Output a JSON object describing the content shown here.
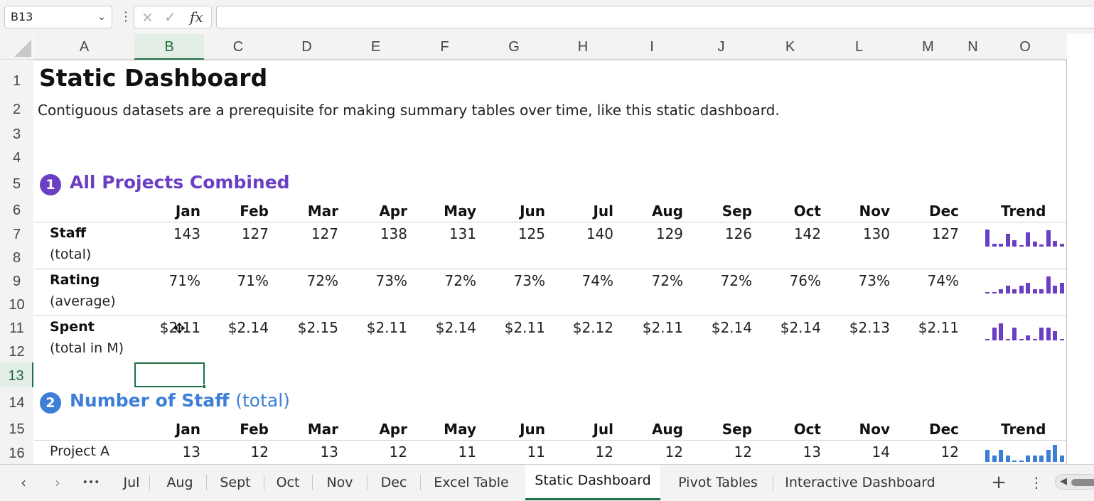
{
  "formula_bar": {
    "name_box": "B13",
    "cancel_icon": "×",
    "enter_icon": "✓",
    "fx_label": "fx",
    "formula_value": ""
  },
  "columns": [
    "A",
    "B",
    "C",
    "D",
    "E",
    "F",
    "G",
    "H",
    "I",
    "J",
    "K",
    "L",
    "M",
    "N",
    "O"
  ],
  "rows": [
    "1",
    "2",
    "3",
    "4",
    "5",
    "6",
    "7",
    "8",
    "9",
    "10",
    "11",
    "12",
    "13",
    "14",
    "15",
    "16"
  ],
  "selected_cell": "B13",
  "sheet": {
    "title": "Static Dashboard",
    "subtitle": "Contiguous datasets are a prerequisite for making summary tables over time, like this static dashboard.",
    "section1": {
      "number": "1",
      "title": "All Projects Combined",
      "color": "#6a3fc4",
      "months": [
        "Jan",
        "Feb",
        "Mar",
        "Apr",
        "May",
        "Jun",
        "Jul",
        "Aug",
        "Sep",
        "Oct",
        "Nov",
        "Dec"
      ],
      "trend_label": "Trend",
      "metrics": [
        {
          "label": "Staff",
          "sub": "(total)",
          "values": [
            "143",
            "127",
            "127",
            "138",
            "131",
            "125",
            "140",
            "129",
            "126",
            "142",
            "130",
            "127"
          ],
          "spark": [
            143,
            127,
            127,
            138,
            131,
            125,
            140,
            129,
            126,
            142,
            130,
            127
          ]
        },
        {
          "label": "Rating",
          "sub": "(average)",
          "values": [
            "71%",
            "71%",
            "72%",
            "73%",
            "72%",
            "73%",
            "74%",
            "72%",
            "72%",
            "76%",
            "73%",
            "74%"
          ],
          "spark": [
            71,
            71,
            72,
            73,
            72,
            73,
            74,
            72,
            72,
            76,
            73,
            74
          ]
        },
        {
          "label": "Spent",
          "sub": "(total in M)",
          "values": [
            "$2.11",
            "$2.14",
            "$2.15",
            "$2.11",
            "$2.14",
            "$2.11",
            "$2.12",
            "$2.11",
            "$2.14",
            "$2.14",
            "$2.13",
            "$2.11"
          ],
          "spark": [
            2.11,
            2.14,
            2.15,
            2.11,
            2.14,
            2.11,
            2.12,
            2.11,
            2.14,
            2.14,
            2.13,
            2.11
          ]
        }
      ]
    },
    "section2": {
      "number": "2",
      "title": "Number of Staff",
      "title_suffix": "(total)",
      "color": "#3d7fd6",
      "months": [
        "Jan",
        "Feb",
        "Mar",
        "Apr",
        "May",
        "Jun",
        "Jul",
        "Aug",
        "Sep",
        "Oct",
        "Nov",
        "Dec"
      ],
      "trend_label": "Trend",
      "rows": [
        {
          "label": "Project A",
          "values": [
            "13",
            "12",
            "13",
            "12",
            "11",
            "11",
            "12",
            "12",
            "12",
            "13",
            "14",
            "12"
          ],
          "spark": [
            13,
            12,
            13,
            12,
            11,
            11,
            12,
            12,
            12,
            13,
            14,
            12
          ]
        }
      ]
    }
  },
  "tabs": {
    "prev": "‹",
    "next": "›",
    "more": "•••",
    "items": [
      "Jul",
      "Aug",
      "Sept",
      "Oct",
      "Nov",
      "Dec",
      "Excel Table",
      "Static Dashboard",
      "Pivot Tables",
      "Interactive Dashboard"
    ],
    "active": "Static Dashboard",
    "add": "+",
    "menu": "⋮"
  }
}
